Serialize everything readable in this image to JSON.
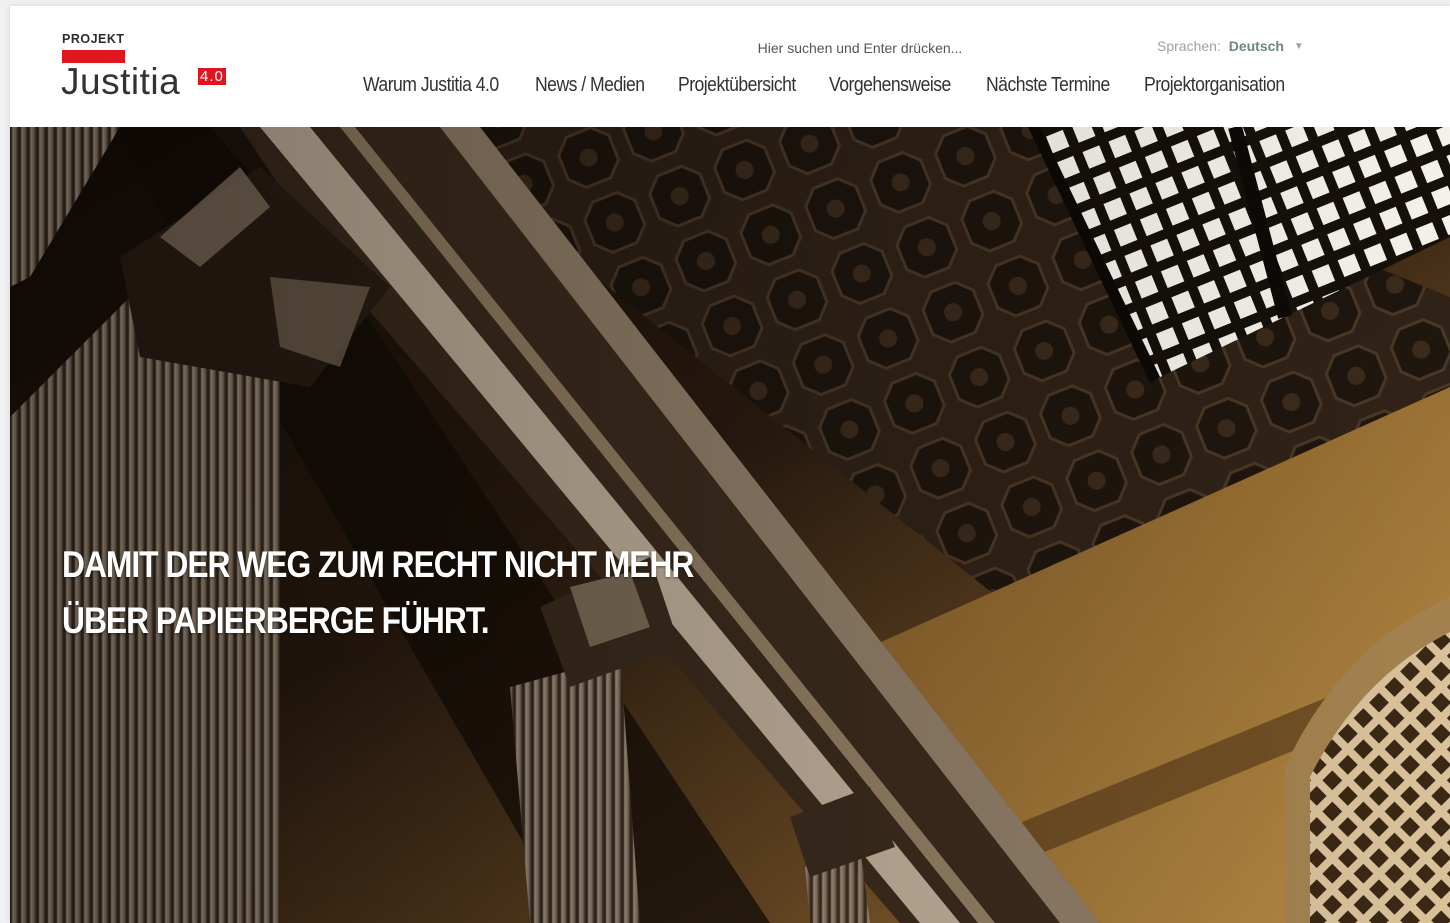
{
  "logo": {
    "small": "PROJEKT",
    "main": "Justitia",
    "version": "4.0"
  },
  "search": {
    "placeholder": "Hier suchen und Enter drücken..."
  },
  "language": {
    "label": "Sprachen:",
    "value": "Deutsch",
    "caret_icon": "caret-down-icon"
  },
  "nav": {
    "items": [
      {
        "label": "Warum Justitia 4.0"
      },
      {
        "label": "News / Medien"
      },
      {
        "label": "Projektübersicht"
      },
      {
        "label": "Vorgehensweise"
      },
      {
        "label": "Nächste Termine"
      },
      {
        "label": "Projektorganisation"
      }
    ]
  },
  "hero": {
    "line1": "Damit der Weg zum Recht nicht mehr",
    "line2": "über Papierberge führt.",
    "image": "courthouse-columns-ceiling"
  },
  "colors": {
    "brand_red": "#e0151f",
    "text_dark": "#333333",
    "lang_value": "#6e8686"
  }
}
